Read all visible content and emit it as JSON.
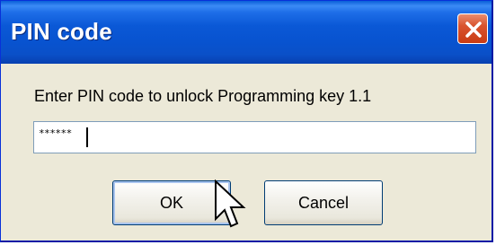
{
  "window": {
    "title": "PIN code"
  },
  "dialog": {
    "prompt": "Enter PIN code to unlock Programming key 1.1",
    "pin_field": {
      "masked_value": "******"
    }
  },
  "buttons": {
    "ok_label": "OK",
    "cancel_label": "Cancel"
  },
  "icons": {
    "close": "close-icon",
    "pointer": "mouse-pointer-icon"
  },
  "colors": {
    "titlebar": "#0a58d6",
    "close_button": "#d9532e",
    "dialog_background": "#ece9d8"
  }
}
